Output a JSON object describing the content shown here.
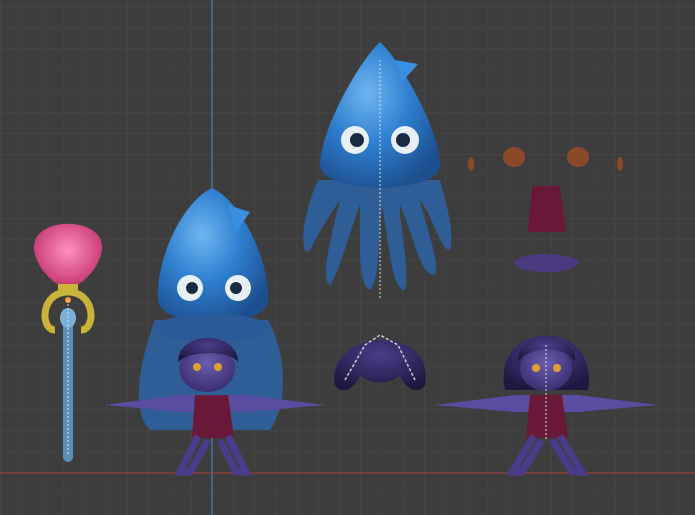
{
  "viewport": {
    "background": "#3d3d3d",
    "grid_color": "#4a4a4a",
    "x_axis_color": "#8a3b3b",
    "y_axis_color": "#4f6f9a"
  },
  "objects": [
    {
      "id": "staff",
      "colors": {
        "shell": "#e0508a",
        "ring": "#c9b43a",
        "shaft": "#5a8fb8"
      }
    },
    {
      "id": "character-with-squid-hat",
      "colors": {
        "hat": "#2f7fd0",
        "skin": "#4a3c8a",
        "dress": "#6a1838"
      }
    },
    {
      "id": "squid-hat",
      "colors": {
        "body": "#2f7fd0",
        "tentacles": "#2f5d95"
      }
    },
    {
      "id": "hair",
      "colors": {
        "hair": "#2e2660"
      }
    },
    {
      "id": "eyebrows",
      "colors": {
        "brow": "#8a4a2a"
      }
    },
    {
      "id": "dress-piece",
      "colors": {
        "dress": "#6a1838"
      }
    },
    {
      "id": "belt-ring",
      "colors": {
        "ring": "#4a3a80"
      }
    },
    {
      "id": "character-base",
      "colors": {
        "skin": "#4a3c8a",
        "hair": "#2e2660",
        "dress": "#6a1838"
      }
    }
  ]
}
